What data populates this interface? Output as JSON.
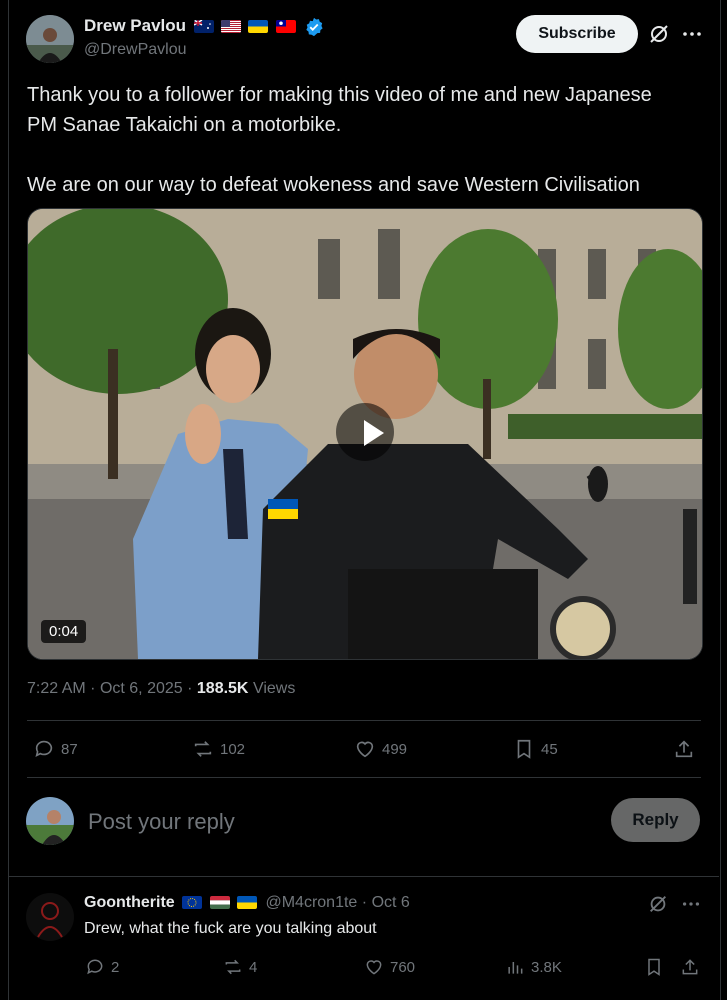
{
  "post": {
    "author_name": "Drew Pavlou",
    "author_handle": "@DrewPavlou",
    "flags": [
      "australia-flag",
      "usa-flag",
      "ukraine-flag",
      "taiwan-flag"
    ],
    "subscribe_label": "Subscribe",
    "text_line1": "Thank you to a follower for making this video of me and new Japanese PM Sanae Takaichi on a motorbike.",
    "text_line2": "We are on our way to defeat wokeness and save Western Civilisation",
    "video_duration": "0:04",
    "time": "7:22 AM",
    "date": "Oct 6, 2025",
    "views_count": "188.5K",
    "views_label": "Views",
    "stats": {
      "replies": "87",
      "reposts": "102",
      "likes": "499",
      "bookmarks": "45"
    }
  },
  "composer": {
    "placeholder": "Post your reply",
    "reply_label": "Reply"
  },
  "reply": {
    "author_name": "Goontherite",
    "flags": [
      "eu-flag",
      "hungary-flag",
      "ukraine-flag"
    ],
    "author_handle": "@M4cron1te",
    "date": "Oct 6",
    "text": "Drew, what the fuck are you talking about",
    "stats": {
      "replies": "2",
      "reposts": "4",
      "likes": "760",
      "views": "3.8K"
    }
  },
  "colors": {
    "background": "#000000",
    "text": "#e7e9ea",
    "muted": "#71767b",
    "verified": "#1d9bf0",
    "border": "#2f3336"
  }
}
